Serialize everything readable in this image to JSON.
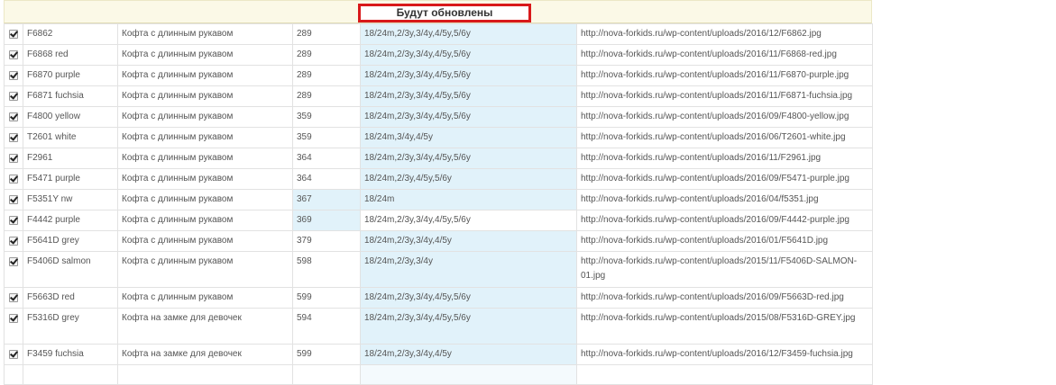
{
  "header": {
    "title": "Будут обновлены"
  },
  "rows": [
    {
      "sku": "F6862",
      "name": "Кофта с длинным рукавом",
      "price": "289",
      "sizes": "18/24m,2/3y,3/4y,4/5y,5/6y",
      "url": "http://nova-forkids.ru/wp-content/uploads/2016/12/F6862.jpg"
    },
    {
      "sku": "F6868 red",
      "name": "Кофта с длинным рукавом",
      "price": "289",
      "sizes": "18/24m,2/3y,3/4y,4/5y,5/6y",
      "url": "http://nova-forkids.ru/wp-content/uploads/2016/11/F6868-red.jpg"
    },
    {
      "sku": "F6870 purple",
      "name": "Кофта с длинным рукавом",
      "price": "289",
      "sizes": "18/24m,2/3y,3/4y,4/5y,5/6y",
      "url": "http://nova-forkids.ru/wp-content/uploads/2016/11/F6870-purple.jpg"
    },
    {
      "sku": "F6871 fuchsia",
      "name": "Кофта с длинным рукавом",
      "price": "289",
      "sizes": "18/24m,2/3y,3/4y,4/5y,5/6y",
      "url": "http://nova-forkids.ru/wp-content/uploads/2016/11/F6871-fuchsia.jpg"
    },
    {
      "sku": "F4800 yellow",
      "name": "Кофта с длинным рукавом",
      "price": "359",
      "sizes": "18/24m,2/3y,3/4y,4/5y,5/6y",
      "url": "http://nova-forkids.ru/wp-content/uploads/2016/09/F4800-yellow.jpg"
    },
    {
      "sku": "T2601 white",
      "name": "Кофта с длинным рукавом",
      "price": "359",
      "sizes": "18/24m,3/4y,4/5y",
      "url": "http://nova-forkids.ru/wp-content/uploads/2016/06/T2601-white.jpg"
    },
    {
      "sku": "F2961",
      "name": "Кофта с длинным рукавом",
      "price": "364",
      "sizes": "18/24m,2/3y,3/4y,4/5y,5/6y",
      "url": "http://nova-forkids.ru/wp-content/uploads/2016/11/F2961.jpg"
    },
    {
      "sku": "F5471 purple",
      "name": "Кофта с длинным рукавом",
      "price": "364",
      "sizes": "18/24m,2/3y,4/5y,5/6y",
      "url": "http://nova-forkids.ru/wp-content/uploads/2016/09/F5471-purple.jpg"
    },
    {
      "sku": "F5351Y nw",
      "name": "Кофта с длинным рукавом",
      "price": "367",
      "sizes": "18/24m",
      "url": "http://nova-forkids.ru/wp-content/uploads/2016/04/f5351.jpg"
    },
    {
      "sku": "F4442 purple",
      "name": "Кофта с длинным рукавом",
      "price": "369",
      "sizes": "18/24m,2/3y,3/4y,4/5y,5/6y",
      "url": "http://nova-forkids.ru/wp-content/uploads/2016/09/F4442-purple.jpg"
    },
    {
      "sku": "F5641D grey",
      "name": "Кофта с длинным рукавом",
      "price": "379",
      "sizes": "18/24m,2/3y,3/4y,4/5y",
      "url": "http://nova-forkids.ru/wp-content/uploads/2016/01/F5641D.jpg"
    },
    {
      "sku": "F5406D salmon",
      "name": "Кофта с длинным рукавом",
      "price": "598",
      "sizes": "18/24m,2/3y,3/4y",
      "url": "http://nova-forkids.ru/wp-content/uploads/2015/11/F5406D-SALMON-01.jpg"
    },
    {
      "sku": "F5663D red",
      "name": "Кофта с длинным рукавом",
      "price": "599",
      "sizes": "18/24m,2/3y,3/4y,4/5y,5/6y",
      "url": "http://nova-forkids.ru/wp-content/uploads/2016/09/F5663D-red.jpg"
    },
    {
      "sku": "F5316D grey",
      "name": "Кофта на замке для девочек",
      "price": "594",
      "sizes": "18/24m,2/3y,3/4y,4/5y,5/6y",
      "url": "http://nova-forkids.ru/wp-content/uploads/2015/08/F5316D-GREY.jpg"
    },
    {
      "sku": "F3459 fuchsia",
      "name": "Кофта на замке для девочек",
      "price": "599",
      "sizes": "18/24m,2/3y,3/4y,4/5y",
      "url": "http://nova-forkids.ru/wp-content/uploads/2016/12/F3459-fuchsia.jpg"
    }
  ]
}
